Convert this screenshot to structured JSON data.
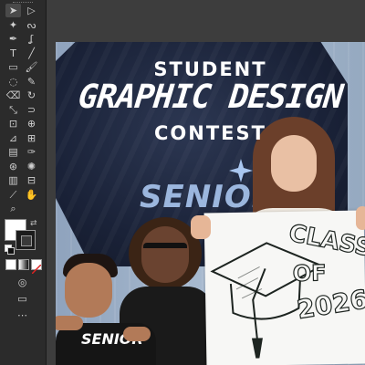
{
  "app": {
    "accent": "#2b2b2b",
    "canvas_bg": "#3d3d3d"
  },
  "toolbar": {
    "tools": [
      {
        "name": "selection-tool-icon",
        "glyph": "➤",
        "active": true
      },
      {
        "name": "direct-selection-tool-icon",
        "glyph": "▷",
        "active": false
      },
      {
        "name": "magic-wand-tool-icon",
        "glyph": "✦",
        "active": false
      },
      {
        "name": "lasso-tool-icon",
        "glyph": "ᔓ",
        "active": false
      },
      {
        "name": "pen-tool-icon",
        "glyph": "✒",
        "active": false
      },
      {
        "name": "curvature-tool-icon",
        "glyph": "ʆ",
        "active": false
      },
      {
        "name": "type-tool-icon",
        "glyph": "T",
        "active": false
      },
      {
        "name": "line-tool-icon",
        "glyph": "╱",
        "active": false
      },
      {
        "name": "rectangle-tool-icon",
        "glyph": "▭",
        "active": false
      },
      {
        "name": "paintbrush-tool-icon",
        "glyph": "🖌",
        "active": false
      },
      {
        "name": "shaper-tool-icon",
        "glyph": "◌",
        "active": false
      },
      {
        "name": "pencil-tool-icon",
        "glyph": "✎",
        "active": false
      },
      {
        "name": "eraser-tool-icon",
        "glyph": "⌫",
        "active": false
      },
      {
        "name": "rotate-tool-icon",
        "glyph": "↻",
        "active": false
      },
      {
        "name": "scale-tool-icon",
        "glyph": "⤡",
        "active": false
      },
      {
        "name": "width-tool-icon",
        "glyph": "⊃",
        "active": false
      },
      {
        "name": "free-transform-tool-icon",
        "glyph": "⊡",
        "active": false
      },
      {
        "name": "shape-builder-tool-icon",
        "glyph": "⊕",
        "active": false
      },
      {
        "name": "perspective-grid-tool-icon",
        "glyph": "⊿",
        "active": false
      },
      {
        "name": "mesh-tool-icon",
        "glyph": "⊞",
        "active": false
      },
      {
        "name": "gradient-tool-icon",
        "glyph": "▤",
        "active": false
      },
      {
        "name": "eyedropper-tool-icon",
        "glyph": "✑",
        "active": false
      },
      {
        "name": "blend-tool-icon",
        "glyph": "⊛",
        "active": false
      },
      {
        "name": "symbol-sprayer-tool-icon",
        "glyph": "✺",
        "active": false
      },
      {
        "name": "column-graph-tool-icon",
        "glyph": "▥",
        "active": false
      },
      {
        "name": "artboard-tool-icon",
        "glyph": "⊟",
        "active": false
      },
      {
        "name": "slice-tool-icon",
        "glyph": "⟋",
        "active": false
      },
      {
        "name": "hand-tool-icon",
        "glyph": "✋",
        "active": false
      },
      {
        "name": "zoom-tool-icon",
        "glyph": "⌕",
        "active": false
      }
    ],
    "fill_color": "#ffffff",
    "stroke_color": "#1c1c1c"
  },
  "artwork": {
    "headline_top": "STUDENT",
    "headline_main": "GRAPHIC DESIGN",
    "headline_bottom": "CONTEST",
    "shirt_text": "SENIOR",
    "boy_shirt_text": "SENIOR",
    "poster_line1": "CLASS",
    "poster_line2": "OF",
    "poster_line3": "2026"
  }
}
